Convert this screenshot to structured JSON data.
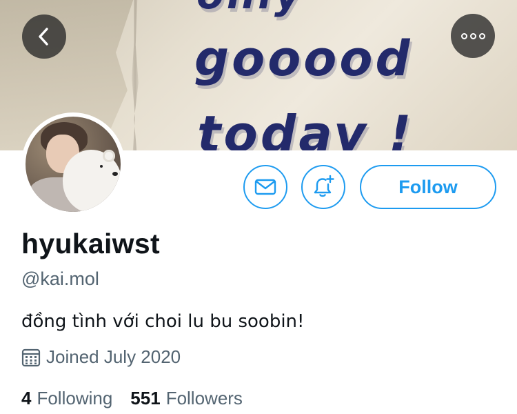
{
  "banner": {
    "neon_line1": "only",
    "neon_line2": "gooood",
    "neon_line3": "today !"
  },
  "nav": {
    "back_icon": "chevron-left-icon",
    "more_icon": "more-horizontal-icon"
  },
  "actions": {
    "message_icon": "mail-icon",
    "notify_icon": "bell-plus-icon",
    "follow_label": "Follow"
  },
  "profile": {
    "display_name": "hyukaiwst",
    "handle": "@kai.mol",
    "bio": "đồng tình với choi lu bu soobin!",
    "joined_icon": "calendar-icon",
    "joined": "Joined July 2020",
    "following_count": "4",
    "following_label": "Following",
    "followers_count": "551",
    "followers_label": "Followers"
  },
  "colors": {
    "accent": "#1d9bf0",
    "text": "#0f1419",
    "secondary": "#536471"
  }
}
